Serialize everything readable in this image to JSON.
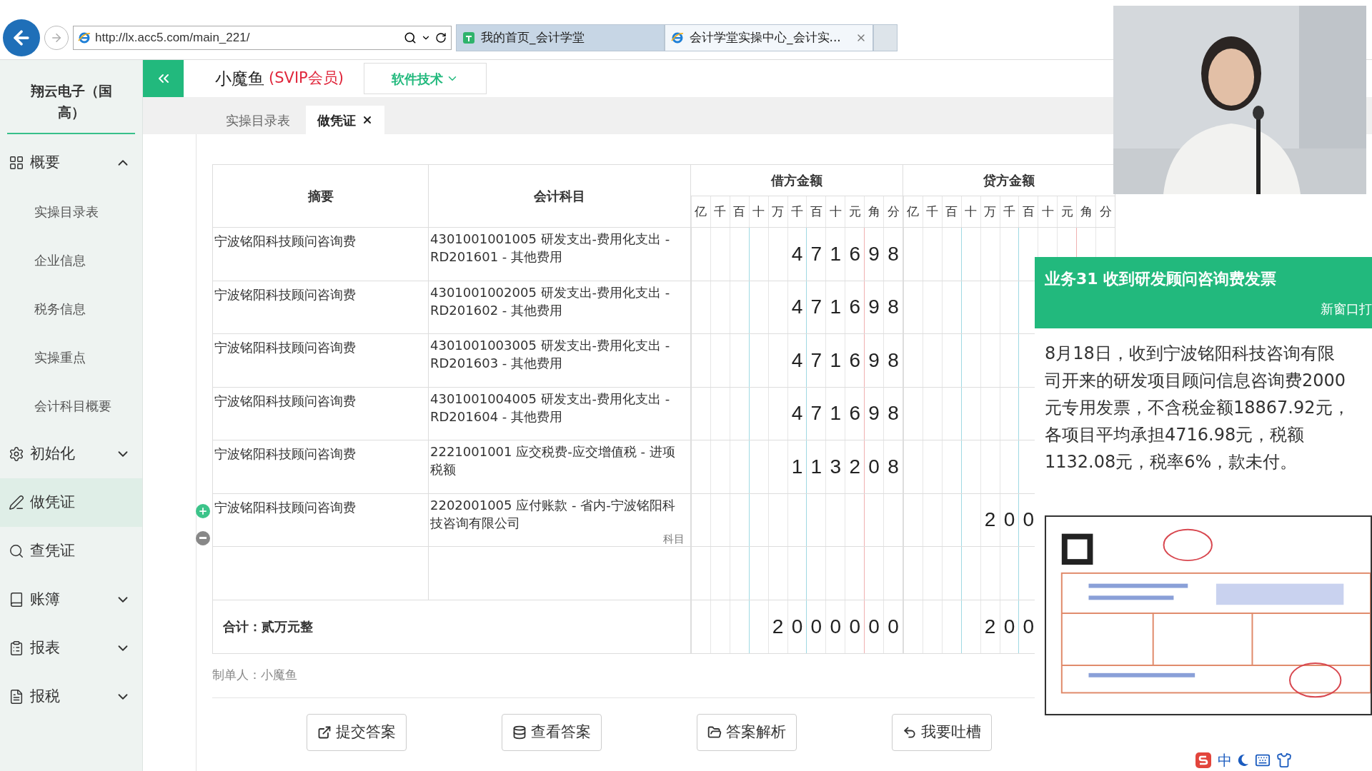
{
  "browser": {
    "address": "http://lx.acc5.com/main_221/",
    "tabs": [
      {
        "title": "我的首页_会计学堂",
        "selected": false,
        "kind": "home"
      },
      {
        "title": "会计学堂实操中心_会计实...",
        "selected": true,
        "kind": "ie"
      }
    ]
  },
  "sidebar": {
    "company": "翔云电子（国高）",
    "items": [
      {
        "label": "概要",
        "selected": false,
        "expanded": true,
        "children": [
          {
            "label": "实操目录表",
            "selected": false
          },
          {
            "label": "企业信息",
            "selected": false
          },
          {
            "label": "税务信息",
            "selected": false
          },
          {
            "label": "实操重点",
            "selected": false
          },
          {
            "label": "会计科目概要",
            "selected": false
          }
        ]
      },
      {
        "label": "初始化",
        "selected": false,
        "expanded": false
      },
      {
        "label": "做凭证",
        "selected": true
      },
      {
        "label": "查凭证",
        "selected": false
      },
      {
        "label": "账簿",
        "selected": false,
        "expanded": false
      },
      {
        "label": "报表",
        "selected": false,
        "expanded": false
      },
      {
        "label": "报税",
        "selected": false,
        "expanded": false
      }
    ]
  },
  "header": {
    "user": "小魔鱼",
    "membership": "(SVIP会员)",
    "menu": "软件技术"
  },
  "tabs": [
    {
      "label": "实操目录表",
      "selected": false
    },
    {
      "label": "做凭证",
      "selected": true
    }
  ],
  "voucher": {
    "columns": {
      "summary": "摘要",
      "account": "会计科目",
      "debit": "借方金额",
      "credit": "贷方金额"
    },
    "debit_units": [
      "亿",
      "千",
      "百",
      "十",
      "万",
      "千",
      "百",
      "十",
      "元",
      "角",
      "分"
    ],
    "credit_units": [
      "亿",
      "千",
      "百",
      "十",
      "万",
      "千",
      "百",
      "十",
      "元",
      "角",
      "分"
    ],
    "rows": [
      {
        "summary": "宁波铭阳科技顾问咨询费",
        "account": "4301001001005 研发支出-费用化支出 - RD201601 - 其他费用",
        "debit": [
          "4",
          "7",
          "1",
          "6",
          "9",
          "8"
        ]
      },
      {
        "summary": "宁波铭阳科技顾问咨询费",
        "account": "4301001002005 研发支出-费用化支出 - RD201602 - 其他费用",
        "debit": [
          "4",
          "7",
          "1",
          "6",
          "9",
          "8"
        ]
      },
      {
        "summary": "宁波铭阳科技顾问咨询费",
        "account": "4301001003005 研发支出-费用化支出 - RD201603 - 其他费用",
        "debit": [
          "4",
          "7",
          "1",
          "6",
          "9",
          "8"
        ]
      },
      {
        "summary": "宁波铭阳科技顾问咨询费",
        "account": "4301001004005 研发支出-费用化支出 - RD201604 - 其他费用",
        "debit": [
          "4",
          "7",
          "1",
          "6",
          "9",
          "8"
        ]
      },
      {
        "summary": "宁波铭阳科技顾问咨询费",
        "account": "2221001001 应交税费-应交增值税 - 进项税额",
        "debit": [
          "1",
          "1",
          "3",
          "2",
          "0",
          "8"
        ]
      },
      {
        "summary": "宁波铭阳科技顾问咨询费",
        "account": "2202001005 应付账款 - 省内-宁波铭阳科技咨询有限公司",
        "hint": "科目",
        "credit": [
          "2",
          "0",
          "0"
        ],
        "row_controls": true
      },
      {}
    ],
    "total": {
      "label": "合计：贰万元整",
      "debit": [
        "2",
        "0",
        "0",
        "0",
        "0",
        "0",
        "0"
      ],
      "credit": [
        "2",
        "0",
        "0"
      ]
    },
    "maker": "制单人：小魔鱼",
    "buttons": [
      {
        "label": "提交答案",
        "kind": "submit"
      },
      {
        "label": "查看答案",
        "kind": "view"
      },
      {
        "label": "答案解析",
        "kind": "analysis"
      },
      {
        "label": "我要吐槽",
        "kind": "feedback"
      }
    ]
  },
  "task": {
    "title": "业务31 收到研发顾问咨询费发票",
    "open_link": "新窗口打",
    "lines": [
      "8月18日，收到宁波铭阳科技咨询有限",
      "司开来的研发项目顾问信息咨询费2000",
      "元专用发票，不含税金额18867.92元，",
      "各项目平均承担4716.98元，税额",
      "1132.08元，税率6%，款未付。"
    ],
    "attachment": {
      "kind": "picture"
    }
  },
  "webcam": {
    "kind": "picture"
  },
  "ime": {
    "mode": "中"
  }
}
